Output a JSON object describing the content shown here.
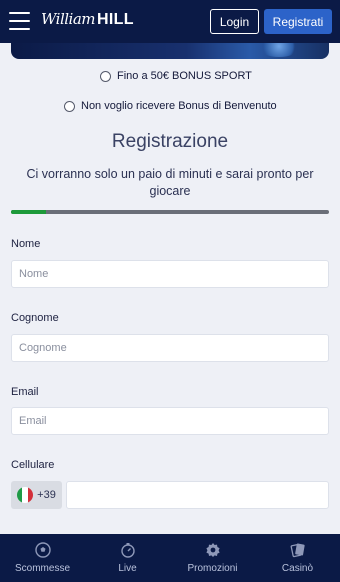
{
  "header": {
    "logo": {
      "script": "William",
      "bold": "HILL"
    },
    "login_label": "Login",
    "register_label": "Registrati"
  },
  "bonus_options": [
    {
      "label": "Fino a 50€ BONUS SPORT",
      "selected": false
    },
    {
      "label": "Non voglio ricevere Bonus di Benvenuto",
      "selected": false
    }
  ],
  "form": {
    "title": "Registrazione",
    "subtitle": "Ci vorranno solo un paio di minuti e sarai pronto per giocare",
    "progress_fraction": 0.11,
    "colors": {
      "progress_fill": "#1d9a3a",
      "progress_track": "#6a6e78",
      "accent": "#2c63c9",
      "navy": "#0b1a46"
    },
    "fields": {
      "nome": {
        "label": "Nome",
        "placeholder": "Nome"
      },
      "cognome": {
        "label": "Cognome",
        "placeholder": "Cognome"
      },
      "email": {
        "label": "Email",
        "placeholder": "Email"
      },
      "cellulare": {
        "label": "Cellulare",
        "prefix": "+39",
        "flag": "italy-flag-icon"
      }
    }
  },
  "bottom_nav": [
    {
      "label": "Scommesse",
      "icon": "soccer-ball-icon"
    },
    {
      "label": "Live",
      "icon": "stopwatch-icon"
    },
    {
      "label": "Promozioni",
      "icon": "gear-badge-icon"
    },
    {
      "label": "Casinò",
      "icon": "playing-cards-icon"
    }
  ]
}
